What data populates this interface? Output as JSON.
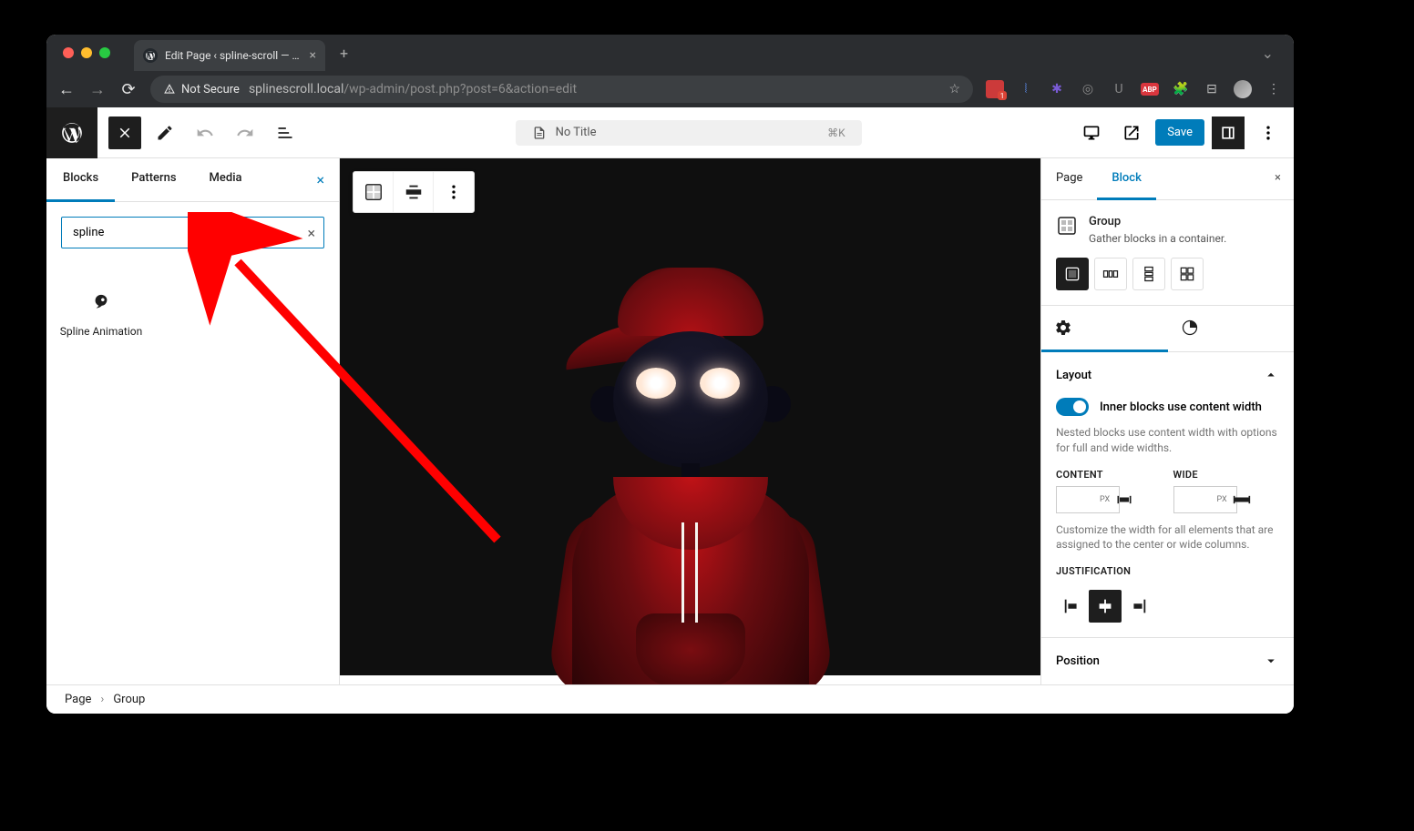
{
  "browser": {
    "tab_title": "Edit Page ‹ spline-scroll — W…",
    "url_host": "splinescroll.local",
    "url_path": "/wp-admin/post.php?post=6&action=edit",
    "not_secure_label": "Not Secure",
    "extension_badge": "1"
  },
  "topbar": {
    "doc_title": "No Title",
    "shortcut": "⌘K",
    "save_label": "Save"
  },
  "inserter": {
    "tabs": {
      "blocks": "Blocks",
      "patterns": "Patterns",
      "media": "Media"
    },
    "search_value": "spline",
    "result_label": "Spline Animation"
  },
  "settings": {
    "page_tab": "Page",
    "block_tab": "Block",
    "block_name": "Group",
    "block_desc": "Gather blocks in a container.",
    "layout_heading": "Layout",
    "toggle_label": "Inner blocks use content width",
    "toggle_help": "Nested blocks use content width with options for full and wide widths.",
    "content_label": "CONTENT",
    "wide_label": "WIDE",
    "unit": "PX",
    "width_help": "Customize the width for all elements that are assigned to the center or wide columns.",
    "justification_label": "JUSTIFICATION",
    "position_heading": "Position"
  },
  "breadcrumb": {
    "root": "Page",
    "current": "Group"
  }
}
